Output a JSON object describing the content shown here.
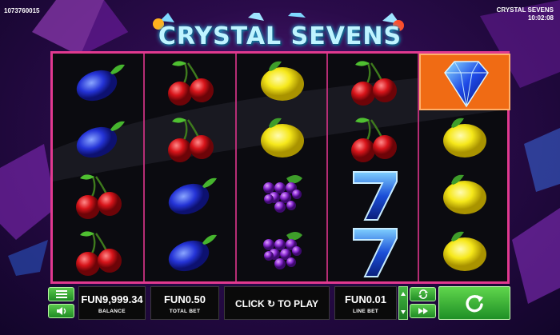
{
  "header": {
    "session_id": "1073760015",
    "game_name": "CRYSTAL SEVENS",
    "time": "10:02:08",
    "logo_text": "CRYSTAL SEVENS"
  },
  "reels": {
    "columns": [
      [
        "plum",
        "plum",
        "cherry",
        "cherry"
      ],
      [
        "cherry",
        "cherry",
        "plum",
        "plum"
      ],
      [
        "lemon",
        "lemon",
        "grapes",
        "grapes"
      ],
      [
        "cherry",
        "cherry",
        "seven",
        "seven"
      ],
      [
        "diamond",
        "lemon",
        "lemon",
        "lemon"
      ]
    ],
    "highlighted_cell": "reel 5, row 1"
  },
  "controls": {
    "balance_value": "FUN9,999.34",
    "balance_label": "BALANCE",
    "total_bet_value": "FUN0.50",
    "total_bet_label": "TOTAL BET",
    "play_text": "CLICK ↻ TO PLAY",
    "line_bet_value": "FUN0.01",
    "line_bet_label": "LINE BET"
  },
  "icons": {
    "menu": "menu-icon",
    "sound": "sound-icon",
    "autoplay": "autoplay-icon",
    "turbo": "fast-forward-icon",
    "spin": "spin-icon"
  },
  "colors": {
    "frame": "#e1398f",
    "button_green": "#3fb23a",
    "highlight": "#f06b14",
    "logo": "#bff4ff"
  }
}
